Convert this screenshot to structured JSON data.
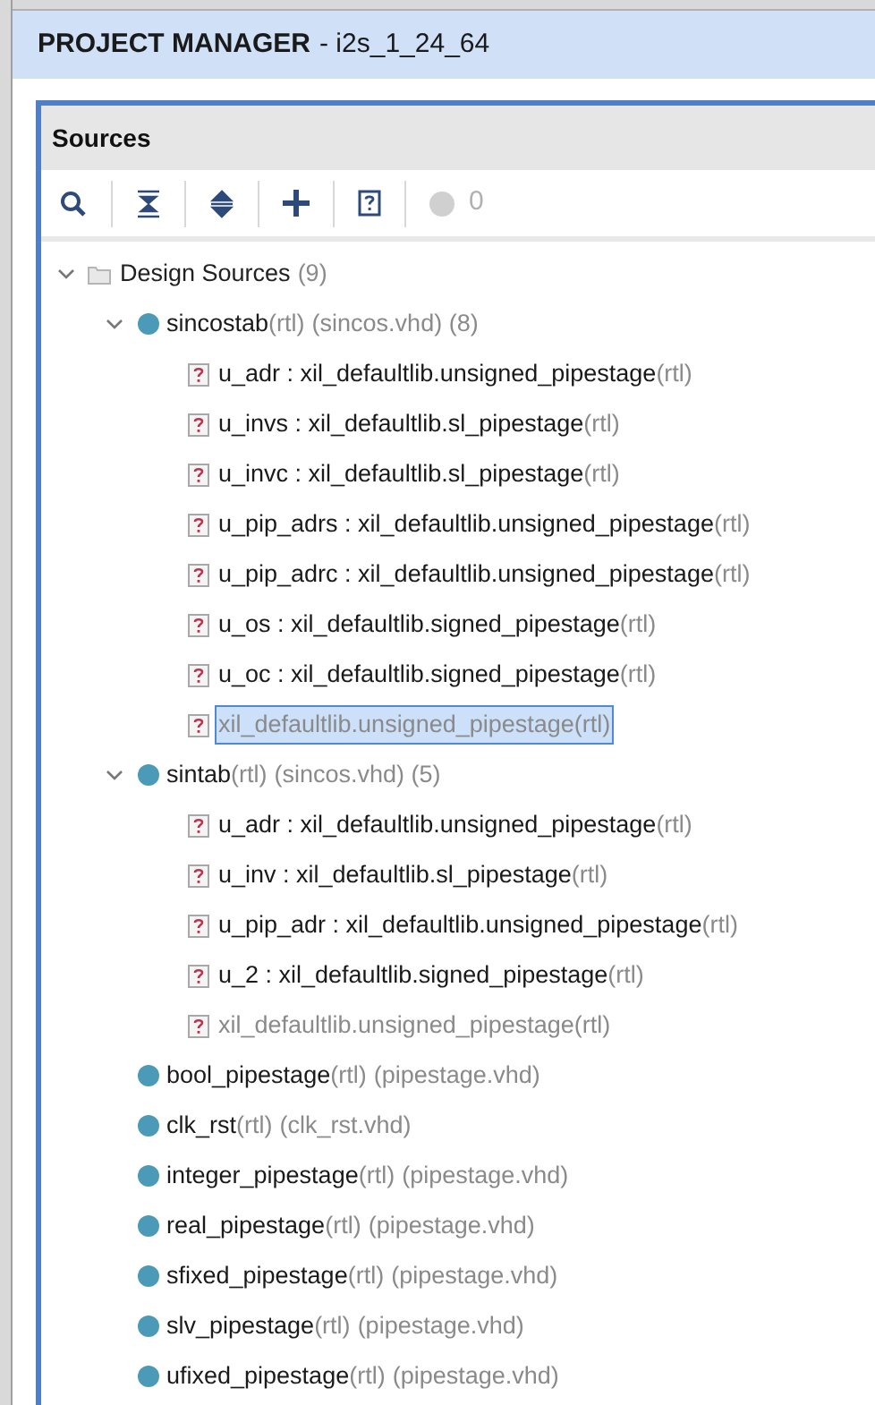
{
  "header": {
    "title": "PROJECT MANAGER",
    "project": "- i2s_1_24_64"
  },
  "panel": {
    "title": "Sources"
  },
  "toolbar": {
    "count": "0"
  },
  "tree": {
    "label": "Design Sources",
    "count": "(9)",
    "expanded": true,
    "selected": false,
    "children": [
      {
        "name": "sincostab",
        "suffix": "(rtl)",
        "detail": "(sincos.vhd) (8)",
        "expanded": true,
        "selected": false,
        "children": [
          {
            "name": "u_adr : xil_defaultlib.unsigned_pipestage",
            "suffix": "(rtl)",
            "dimmed": false,
            "selected": false
          },
          {
            "name": "u_invs : xil_defaultlib.sl_pipestage",
            "suffix": "(rtl)",
            "dimmed": false,
            "selected": false
          },
          {
            "name": "u_invc : xil_defaultlib.sl_pipestage",
            "suffix": "(rtl)",
            "dimmed": false,
            "selected": false
          },
          {
            "name": "u_pip_adrs : xil_defaultlib.unsigned_pipestage",
            "suffix": "(rtl)",
            "dimmed": false,
            "selected": false
          },
          {
            "name": "u_pip_adrc : xil_defaultlib.unsigned_pipestage",
            "suffix": "(rtl)",
            "dimmed": false,
            "selected": false
          },
          {
            "name": "u_os : xil_defaultlib.signed_pipestage",
            "suffix": "(rtl)",
            "dimmed": false,
            "selected": false
          },
          {
            "name": "u_oc : xil_defaultlib.signed_pipestage",
            "suffix": "(rtl)",
            "dimmed": false,
            "selected": false
          },
          {
            "name": "xil_defaultlib.unsigned_pipestage",
            "suffix": "(rtl)",
            "dimmed": true,
            "selected": true
          }
        ]
      },
      {
        "name": "sintab",
        "suffix": "(rtl)",
        "detail": "(sincos.vhd) (5)",
        "expanded": true,
        "selected": false,
        "children": [
          {
            "name": "u_adr : xil_defaultlib.unsigned_pipestage",
            "suffix": "(rtl)",
            "dimmed": false,
            "selected": false
          },
          {
            "name": "u_inv : xil_defaultlib.sl_pipestage",
            "suffix": "(rtl)",
            "dimmed": false,
            "selected": false
          },
          {
            "name": "u_pip_adr : xil_defaultlib.unsigned_pipestage",
            "suffix": "(rtl)",
            "dimmed": false,
            "selected": false
          },
          {
            "name": "u_2 : xil_defaultlib.signed_pipestage",
            "suffix": "(rtl)",
            "dimmed": false,
            "selected": false
          },
          {
            "name": "xil_defaultlib.unsigned_pipestage",
            "suffix": "(rtl)",
            "dimmed": true,
            "selected": false
          }
        ]
      },
      {
        "name": "bool_pipestage",
        "suffix": "(rtl)",
        "detail": "(pipestage.vhd)",
        "selected": false
      },
      {
        "name": "clk_rst",
        "suffix": "(rtl)",
        "detail": "(clk_rst.vhd)",
        "selected": false
      },
      {
        "name": "integer_pipestage",
        "suffix": "(rtl)",
        "detail": "(pipestage.vhd)",
        "selected": false
      },
      {
        "name": "real_pipestage",
        "suffix": "(rtl)",
        "detail": "(pipestage.vhd)",
        "selected": false
      },
      {
        "name": "sfixed_pipestage",
        "suffix": "(rtl)",
        "detail": "(pipestage.vhd)",
        "selected": false
      },
      {
        "name": "slv_pipestage",
        "suffix": "(rtl)",
        "detail": "(pipestage.vhd)",
        "selected": false
      },
      {
        "name": "ufixed_pipestage",
        "suffix": "(rtl)",
        "detail": "(pipestage.vhd)",
        "selected": false
      }
    ]
  }
}
